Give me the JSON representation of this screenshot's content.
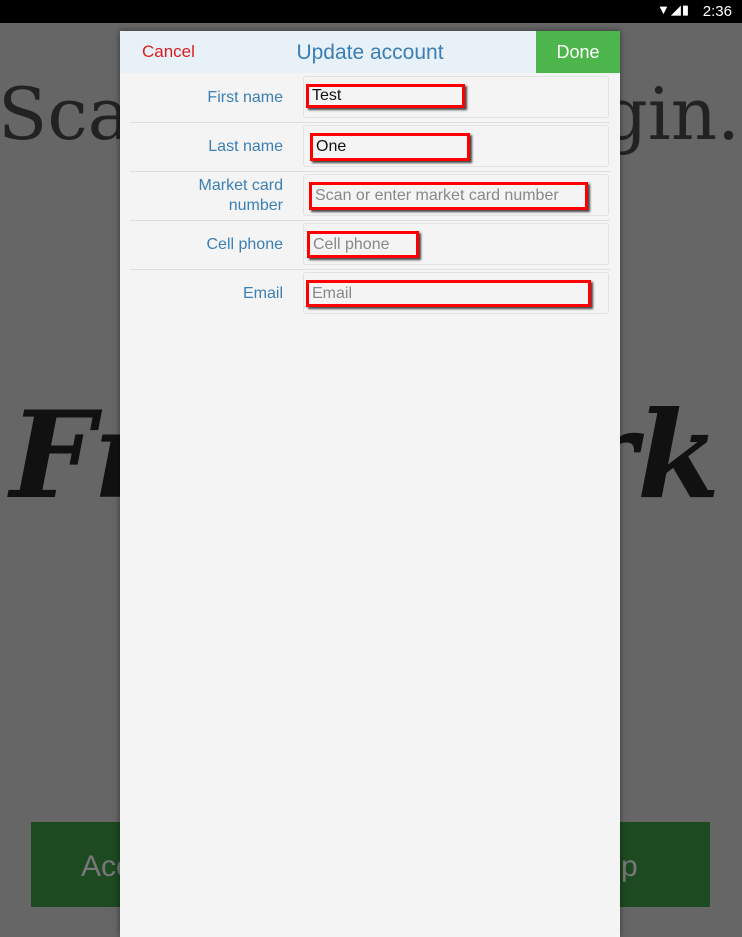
{
  "status_bar": {
    "time": "2:36",
    "icons": [
      "wifi-icon",
      "signal-icon",
      "battery-icon"
    ]
  },
  "background": {
    "heading_left": "Sca",
    "heading_right": "gin.",
    "script_left": "Fr",
    "script_right": "ork",
    "button_left": "Acc",
    "button_right": "p"
  },
  "dialog": {
    "cancel_label": "Cancel",
    "title": "Update account",
    "done_label": "Done",
    "fields": [
      {
        "label": "First name",
        "value": "Test",
        "placeholder": ""
      },
      {
        "label": "Last name",
        "value": "One",
        "placeholder": ""
      },
      {
        "label": "Market card number",
        "value": "",
        "placeholder": "Scan or enter market card number"
      },
      {
        "label": "Cell phone",
        "value": "",
        "placeholder": "Cell phone"
      },
      {
        "label": "Email",
        "value": "",
        "placeholder": "Email"
      }
    ]
  },
  "colors": {
    "cancel": "#d62020",
    "title": "#3a7fb5",
    "done_bg": "#4cb64c",
    "highlight": "#ff0000"
  }
}
